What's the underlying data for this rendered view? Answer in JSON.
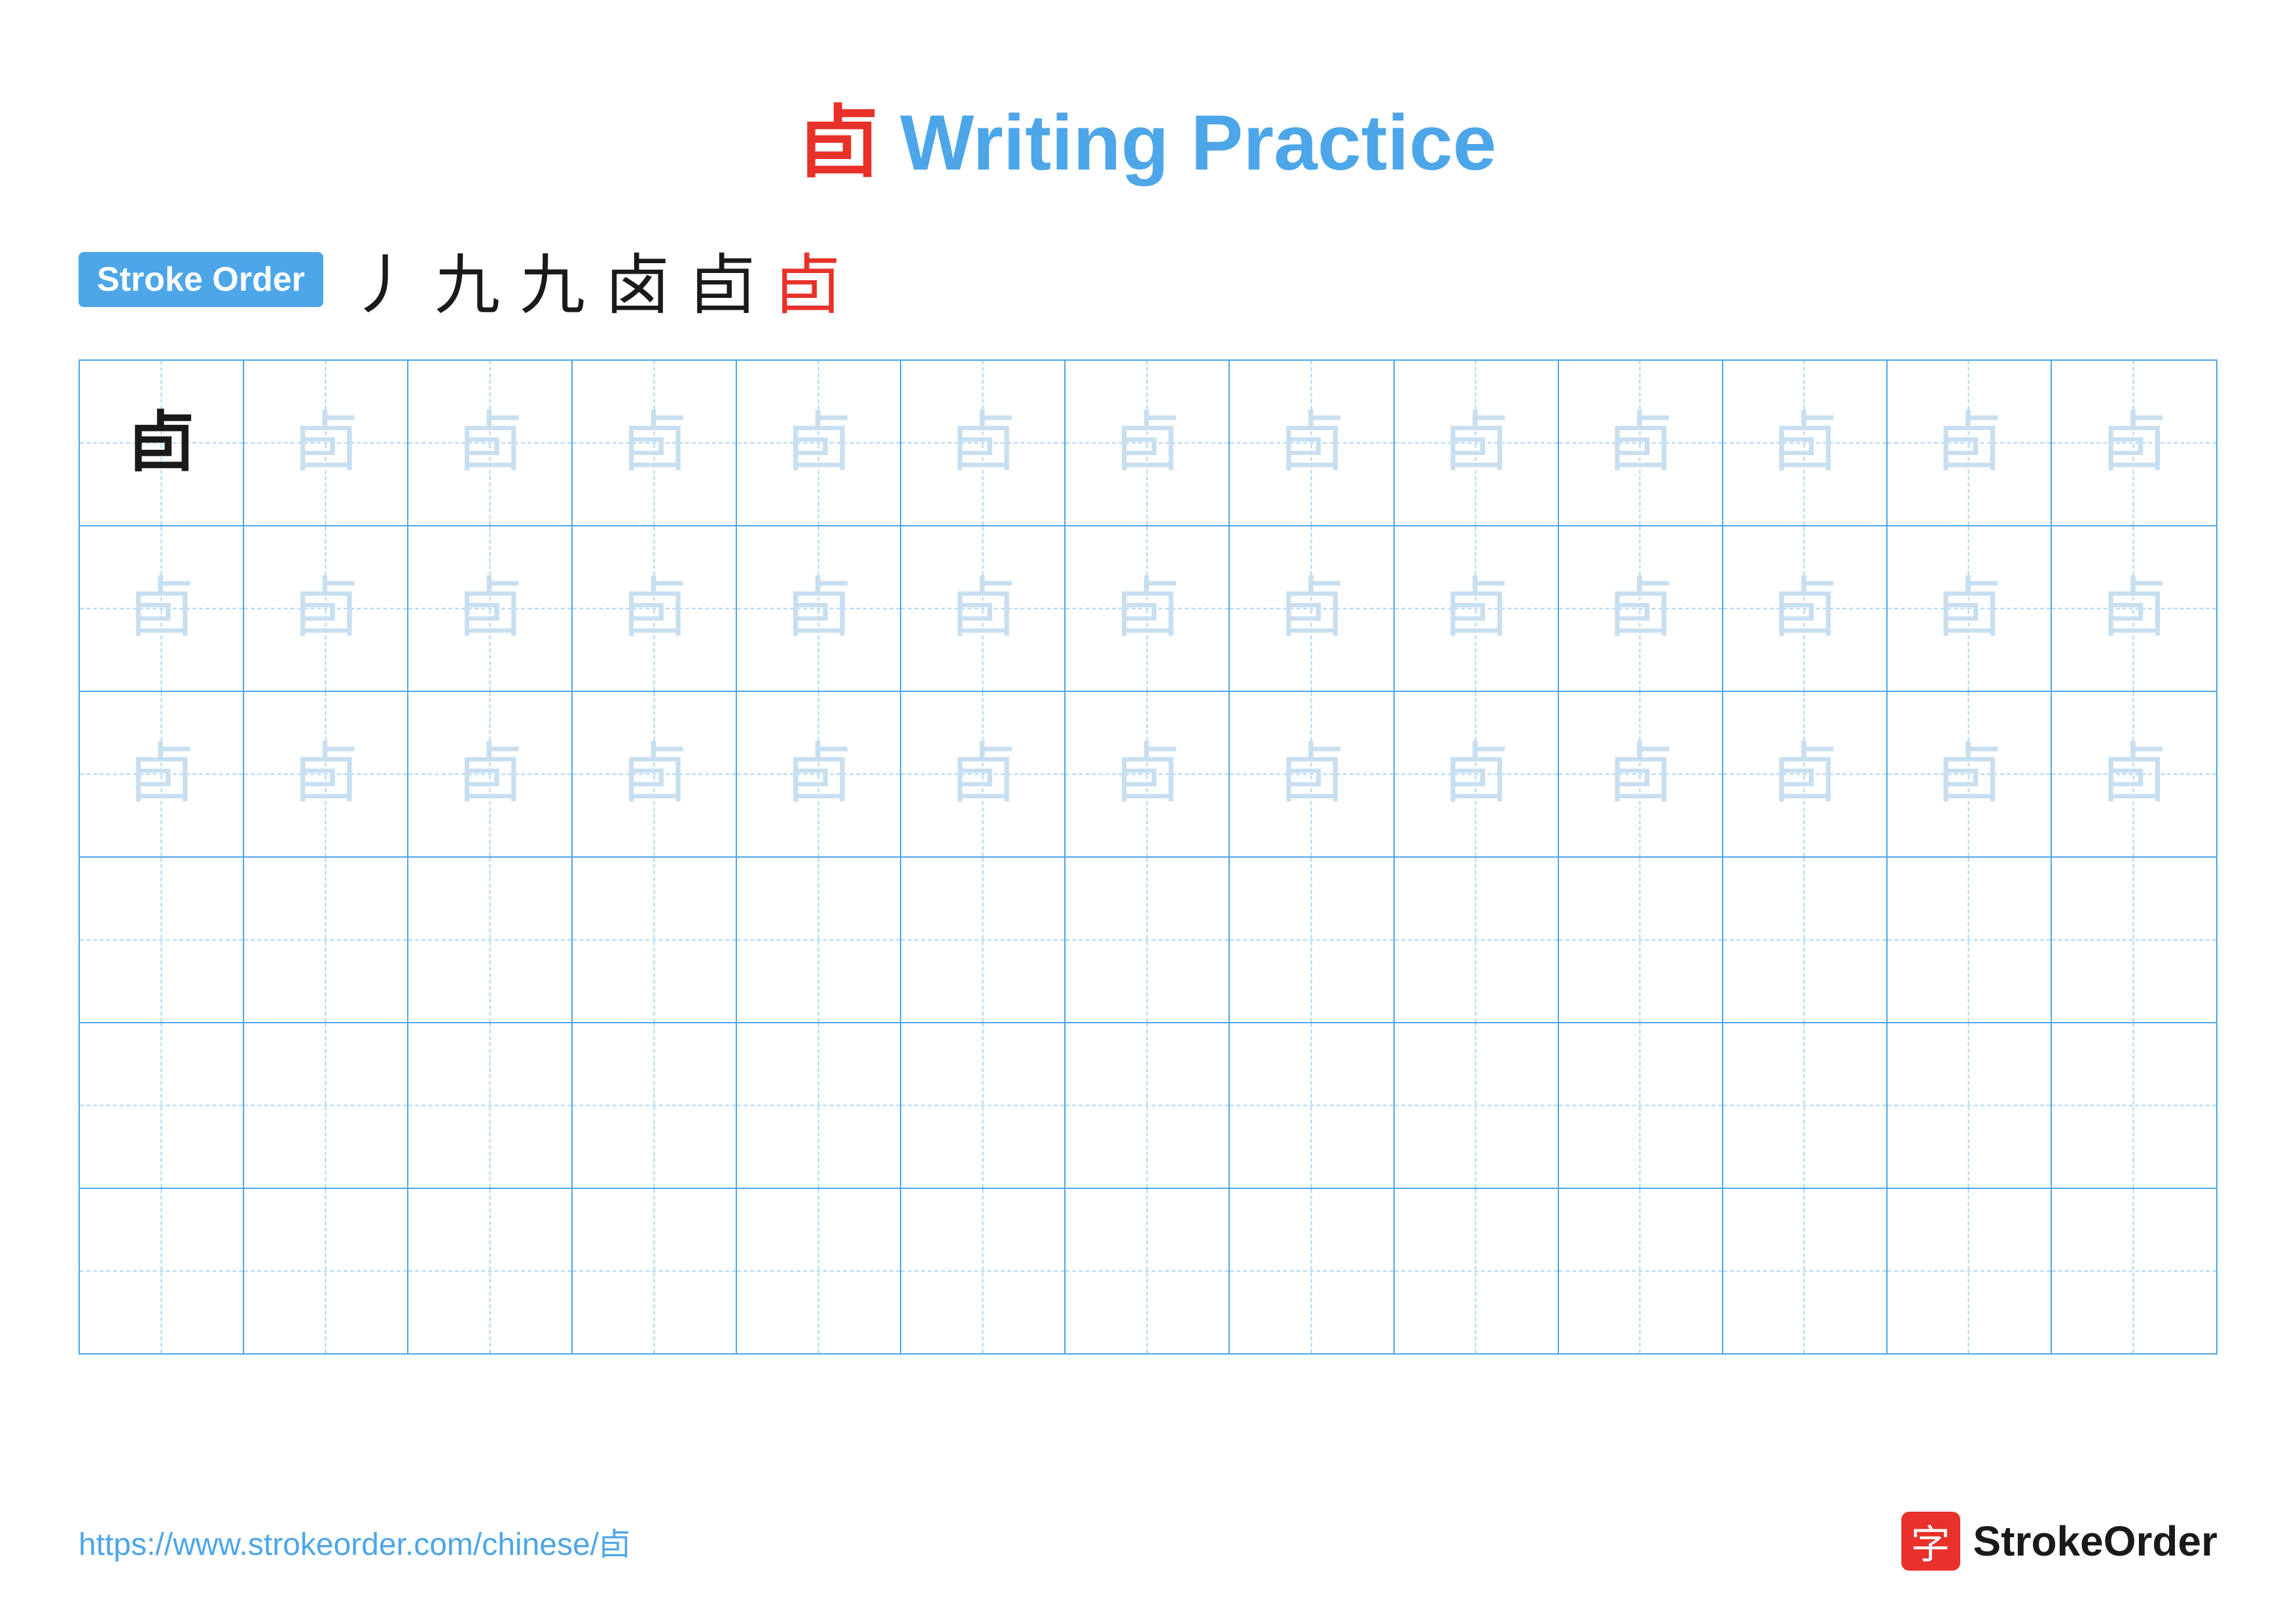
{
  "title": {
    "char": "卣",
    "text": " Writing Practice",
    "full_display": "卣 Writing Practice"
  },
  "stroke_order": {
    "badge_label": "Stroke Order",
    "strokes": [
      "丿",
      "九",
      "九",
      "卤",
      "卣",
      "卣"
    ]
  },
  "grid": {
    "rows": 6,
    "cols": 13,
    "character": "卣",
    "row1_chars": [
      "dark",
      "light",
      "light",
      "light",
      "light",
      "light",
      "light",
      "light",
      "light",
      "light",
      "light",
      "light",
      "light"
    ],
    "row2_chars": [
      "light",
      "light",
      "light",
      "light",
      "light",
      "light",
      "light",
      "light",
      "light",
      "light",
      "light",
      "light",
      "light"
    ],
    "row3_chars": [
      "light",
      "light",
      "light",
      "light",
      "light",
      "light",
      "light",
      "light",
      "light",
      "light",
      "light",
      "light",
      "light"
    ],
    "row4_chars": [
      "empty",
      "empty",
      "empty",
      "empty",
      "empty",
      "empty",
      "empty",
      "empty",
      "empty",
      "empty",
      "empty",
      "empty",
      "empty"
    ],
    "row5_chars": [
      "empty",
      "empty",
      "empty",
      "empty",
      "empty",
      "empty",
      "empty",
      "empty",
      "empty",
      "empty",
      "empty",
      "empty",
      "empty"
    ],
    "row6_chars": [
      "empty",
      "empty",
      "empty",
      "empty",
      "empty",
      "empty",
      "empty",
      "empty",
      "empty",
      "empty",
      "empty",
      "empty",
      "empty"
    ]
  },
  "footer": {
    "url": "https://www.strokeorder.com/chinese/卣",
    "logo_text": "StrokeOrder",
    "logo_icon": "字"
  }
}
